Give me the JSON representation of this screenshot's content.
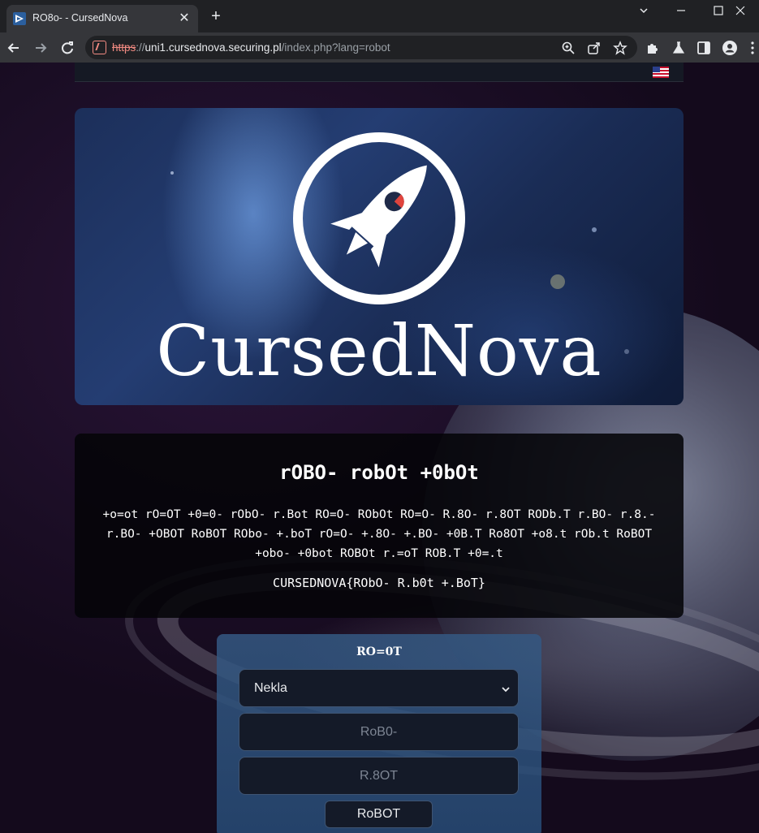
{
  "browser": {
    "tab_title": "RO8o- - CursedNova",
    "url_scheme": "https",
    "url_separator": "://",
    "url_host": "uni1.cursednova.securing.pl",
    "url_path": "/index.php?lang=robot"
  },
  "page": {
    "language_flag": "us-flag-icon",
    "banner_title": "CursedNova",
    "message": {
      "title": "rOBO- robOt +0bOt",
      "body": "+o=ot rO=OT +0=0- rObO- r.Bot RO=O- RObOt RO=O- R.8O- r.8OT RODb.T r.BO- r.8.- r.BO- +OBOT RoBOT RObo- +.boT rO=O- +.8O- +.BO- +0B.T Ro8OT +o8.t rOb.t RoBOT +obo- +0bot ROBOt r.=oT ROB.T +0=.t",
      "flag_text": "CURSEDNOVA{RObO- R.b0t +.BoT}"
    },
    "form": {
      "title": "RO=0T",
      "select_value": "Nekla",
      "username_placeholder": "RoB0-",
      "password_placeholder": "R.8OT",
      "submit_label": "RoBOT"
    }
  },
  "colors": {
    "accent_warning": "#f28b82",
    "form_bg": "#345882",
    "field_bg": "#141a28"
  }
}
